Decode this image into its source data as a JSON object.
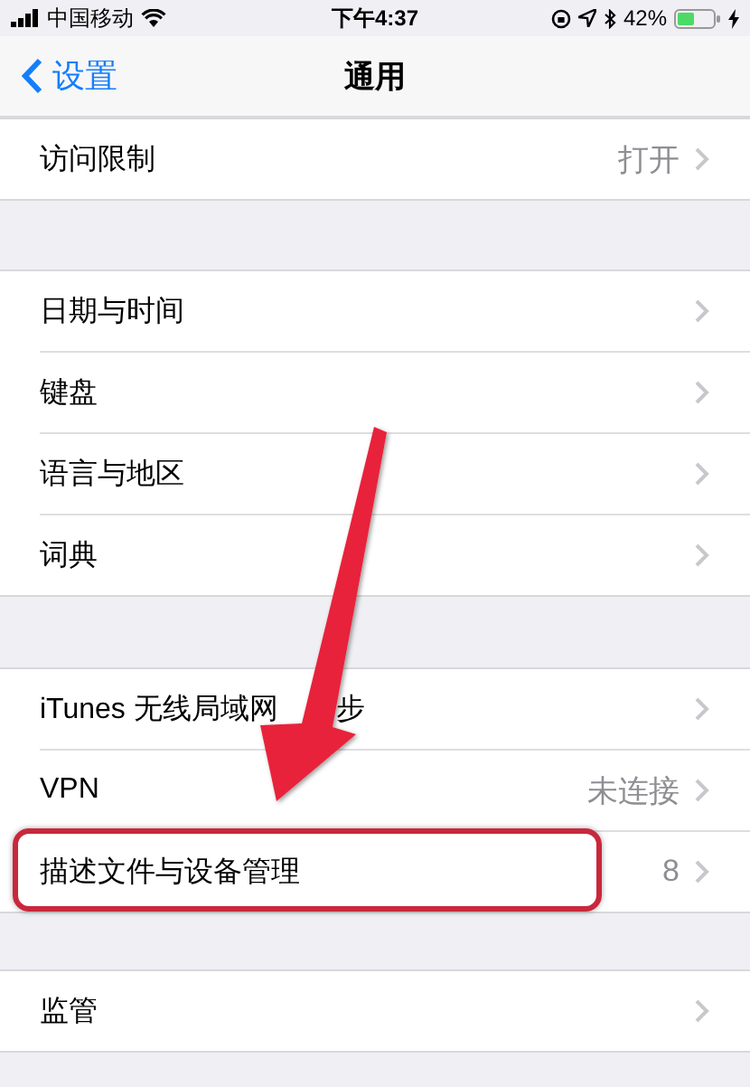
{
  "status_bar": {
    "carrier": "中国移动",
    "time": "下午4:37",
    "battery": "42%"
  },
  "nav": {
    "back": "设置",
    "title": "通用"
  },
  "groups": [
    {
      "rows": [
        {
          "label": "访问限制",
          "value": "打开",
          "highlighted": false
        }
      ]
    },
    {
      "rows": [
        {
          "label": "日期与时间",
          "highlighted": false
        },
        {
          "label": "键盘",
          "highlighted": false
        },
        {
          "label": "语言与地区",
          "highlighted": false
        },
        {
          "label": "词典",
          "highlighted": false
        }
      ]
    },
    {
      "rows": [
        {
          "label": "iTunes 无线局域网",
          "label_tail": "步",
          "highlighted": false
        },
        {
          "label": "VPN",
          "value": "未连接",
          "highlighted": false
        },
        {
          "label": "描述文件与设备管理",
          "value": "8",
          "highlighted": true
        }
      ]
    },
    {
      "rows": [
        {
          "label": "监管",
          "highlighted": false
        }
      ]
    }
  ]
}
